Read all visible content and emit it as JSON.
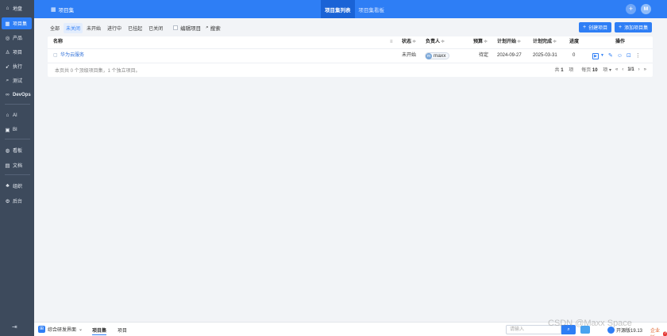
{
  "sidebar": {
    "items": [
      {
        "label": "地盘",
        "icon": "home-icon",
        "glyph": "⌂"
      },
      {
        "label": "项目集",
        "icon": "program-icon",
        "glyph": "▦"
      },
      {
        "label": "产品",
        "icon": "product-icon",
        "glyph": "◎"
      },
      {
        "label": "项目",
        "icon": "project-icon",
        "glyph": "♙"
      },
      {
        "label": "执行",
        "icon": "execution-icon",
        "glyph": "➹"
      },
      {
        "label": "测试",
        "icon": "test-icon",
        "glyph": "⌕"
      },
      {
        "label": "DevOps",
        "icon": "devops-icon",
        "glyph": "∞"
      },
      {
        "label": "AI",
        "icon": "ai-icon",
        "glyph": "⌂"
      },
      {
        "label": "BI",
        "icon": "bi-icon",
        "glyph": "▣"
      },
      {
        "label": "看板",
        "icon": "kanban-icon",
        "glyph": "◍"
      },
      {
        "label": "文档",
        "icon": "doc-icon",
        "glyph": "▤"
      },
      {
        "label": "组织",
        "icon": "org-icon",
        "glyph": "♣"
      },
      {
        "label": "后台",
        "icon": "admin-icon",
        "glyph": "⚙"
      }
    ],
    "collapse_glyph": "⇥"
  },
  "header": {
    "title": "项目集",
    "title_glyph": "▦",
    "tabs": [
      {
        "label": "项目集列表",
        "active": true
      },
      {
        "label": "项目集看板",
        "active": false
      }
    ],
    "plus_glyph": "+",
    "avatar_letter": "M"
  },
  "filter": {
    "tabs": [
      "全部",
      "未关闭",
      "未开始",
      "进行中",
      "已挂起",
      "已关闭"
    ],
    "active_index": 1,
    "edit_projects_label": "编辑项目",
    "search_label": "搜索",
    "search_glyph": "⌕"
  },
  "actions": {
    "create_project": "创建项目",
    "add_program": "添加项目集"
  },
  "table": {
    "columns": {
      "name": "名称",
      "status": "状态",
      "owner": "负责人",
      "budget": "预算",
      "plan_start": "计划开始",
      "plan_end": "计划完成",
      "progress": "进度",
      "actions": "操作"
    },
    "sort_glyph": "≑",
    "filter_glyph": "≡",
    "rows": [
      {
        "name": "华为云服务",
        "status": "未开始",
        "owner": "maxx",
        "budget": "待定",
        "plan_start": "2024-09-27",
        "plan_end": "2025-03-31",
        "progress": "0"
      }
    ],
    "footer_summary": "本页共 0 个顶级项目集，1 个独立项目。",
    "pager": {
      "total_prefix": "共",
      "total": "1",
      "total_suffix": "项",
      "per_page_prefix": "每页",
      "per_page": "10",
      "per_page_suffix": "项",
      "page": "1/1"
    }
  },
  "bottombar": {
    "app_label": "综合研发界面",
    "tabs": [
      "项目集",
      "项目"
    ],
    "search_placeholder": "请输入",
    "version": "开源版19.13",
    "edition": "企业版",
    "badge": "?"
  },
  "watermark": "CSDN @Maxx Space",
  "colors": {
    "primary": "#2e7ef5",
    "sidebar": "#3d4a5c",
    "header": "#2e7ef5"
  }
}
